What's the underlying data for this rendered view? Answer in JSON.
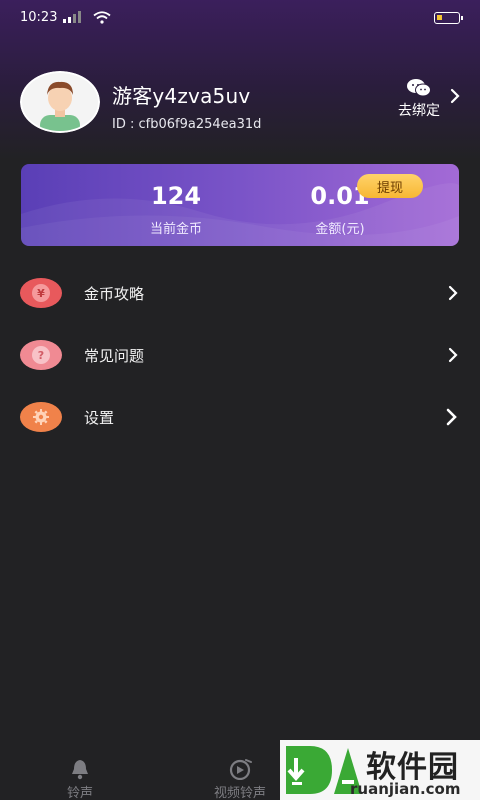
{
  "status_bar": {
    "time": "10:23"
  },
  "profile": {
    "username": "游客y4zva5uv",
    "user_id": "ID : cfb06f9a254ea31d",
    "bind_label": "去绑定"
  },
  "coin_card": {
    "coins_value": "124",
    "coins_label": "当前金币",
    "amount_value": "0.01",
    "amount_label": "金额(元)",
    "withdraw_label": "提现"
  },
  "menu": [
    {
      "label": "金币攻略",
      "icon": "yen-icon",
      "color": "#e8595c"
    },
    {
      "label": "常见问题",
      "icon": "question-icon",
      "color": "#f08a93"
    },
    {
      "label": "设置",
      "icon": "gear-icon",
      "color": "#f0824a"
    }
  ],
  "bottom_nav": [
    {
      "label": "铃声",
      "icon": "bell-icon"
    },
    {
      "label": "视频铃声",
      "icon": "video-ringtone-icon"
    }
  ],
  "watermark": {
    "cn": "软件园",
    "en": "ruanjian.com"
  },
  "colors": {
    "background": "#222224",
    "card_start": "#5a3fb6",
    "card_end": "#a36ad6",
    "withdraw": "#f7b733"
  }
}
